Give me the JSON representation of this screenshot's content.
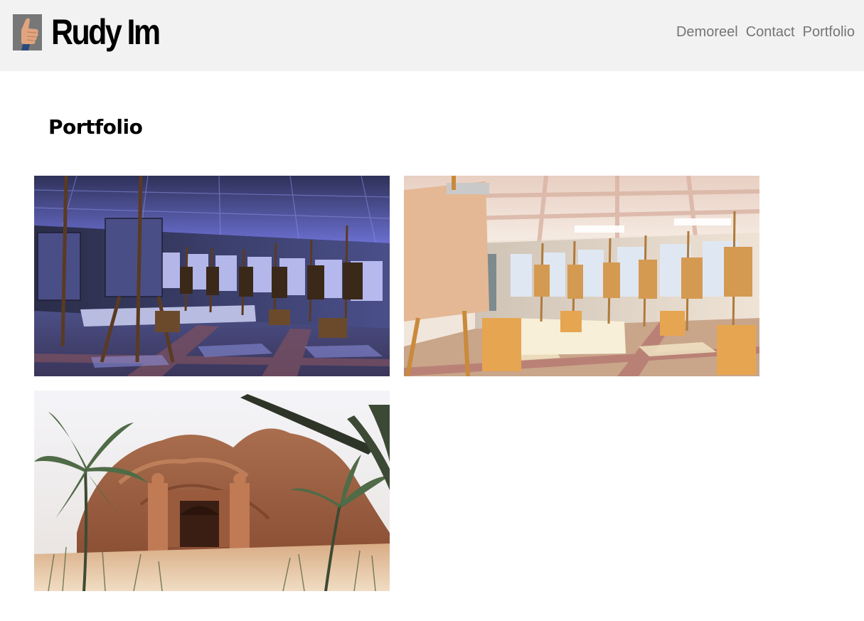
{
  "site": {
    "title": "Rudy Im",
    "logo_icon": "thumbs-up-icon"
  },
  "nav": {
    "items": [
      {
        "label": "Demoreel"
      },
      {
        "label": "Contact"
      },
      {
        "label": "Portfolio"
      }
    ]
  },
  "main": {
    "heading": "Portfolio",
    "gallery": [
      {
        "subject": "art-studio-blue-light"
      },
      {
        "subject": "art-studio-warm-light"
      },
      {
        "subject": "jungle-temple-cave"
      }
    ]
  },
  "colors": {
    "header_bg": "#f2f2f2",
    "nav_text": "#757575",
    "title_text": "#000000"
  }
}
